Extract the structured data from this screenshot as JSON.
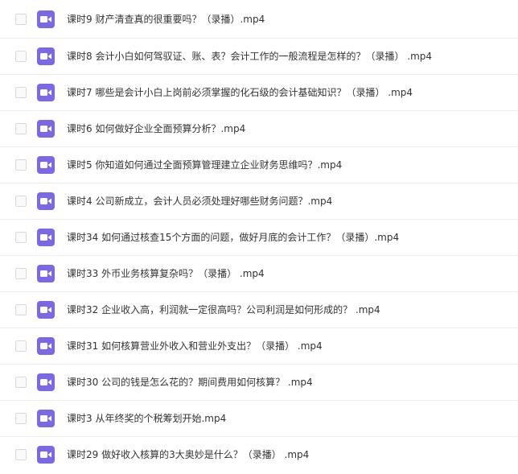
{
  "files": [
    {
      "name": "课时9 财产清查真的很重要吗？（录播）.mp4"
    },
    {
      "name": "课时8 会计小白如何驾驭证、账、表？会计工作的一般流程是怎样的？（录播） .mp4"
    },
    {
      "name": "课时7 哪些是会计小白上岗前必须掌握的化石级的会计基础知识？（录播） .mp4"
    },
    {
      "name": "课时6 如何做好企业全面预算分析？.mp4"
    },
    {
      "name": "课时5 你知道如何通过全面预算管理建立企业财务思维吗？.mp4"
    },
    {
      "name": "课时4 公司新成立，会计人员必须处理好哪些财务问题？.mp4"
    },
    {
      "name": "课时34 如何通过核查15个方面的问题，做好月底的会计工作？（录播）.mp4"
    },
    {
      "name": "课时33 外币业务核算复杂吗？（录播） .mp4"
    },
    {
      "name": "课时32 企业收入高，利润就一定很高吗？公司利润是如何形成的？ .mp4"
    },
    {
      "name": "课时31 如何核算营业外收入和营业外支出？（录播） .mp4"
    },
    {
      "name": "课时30 公司的钱是怎么花的？期间费用如何核算？ .mp4"
    },
    {
      "name": "课时3 从年终奖的个税筹划开始.mp4"
    },
    {
      "name": "课时29 做好收入核算的3大奥妙是什么？（录播） .mp4"
    }
  ],
  "icon": {
    "name": "video-icon",
    "color": "#7b68e6"
  }
}
